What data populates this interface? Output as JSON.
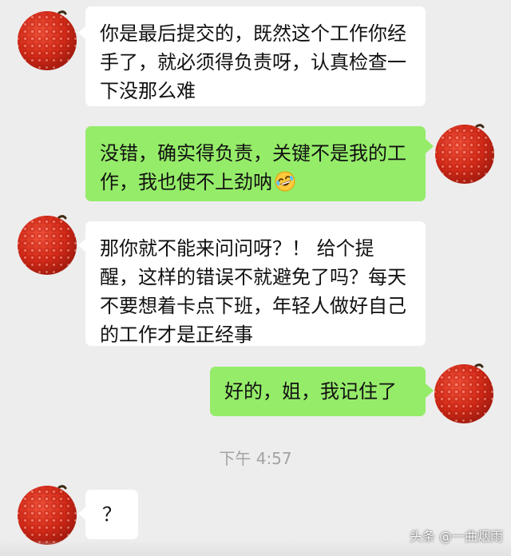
{
  "messages": [
    {
      "side": "left",
      "text": "你是最后提交的，既然这个工作你经手了，就必须得负责呀，认真检查一下没那么难"
    },
    {
      "side": "right",
      "text": "没错，确实得负责，关键不是我的工作，我也使不上劲呐",
      "emoji": "rolling-on-floor-laughing-emoji"
    },
    {
      "side": "left",
      "text": "那你就不能来问问呀？！ 给个提醒，这样的错误不就避免了吗？每天不要想着卡点下班，年轻人做好自己的工作才是正经事"
    },
    {
      "side": "right",
      "text": "好的，姐，我记住了"
    },
    {
      "side": "left",
      "text": "？"
    }
  ],
  "timestamp": "下午 4:57",
  "watermark": "头条 @一曲烟雨",
  "colors": {
    "background": "#ededed",
    "left_bubble": "#ffffff",
    "right_bubble": "#95ec69",
    "avatar": "#d62f1f",
    "timestamp": "#a3a3a3"
  },
  "icons": {
    "avatar": "lychee-avatar-icon"
  }
}
